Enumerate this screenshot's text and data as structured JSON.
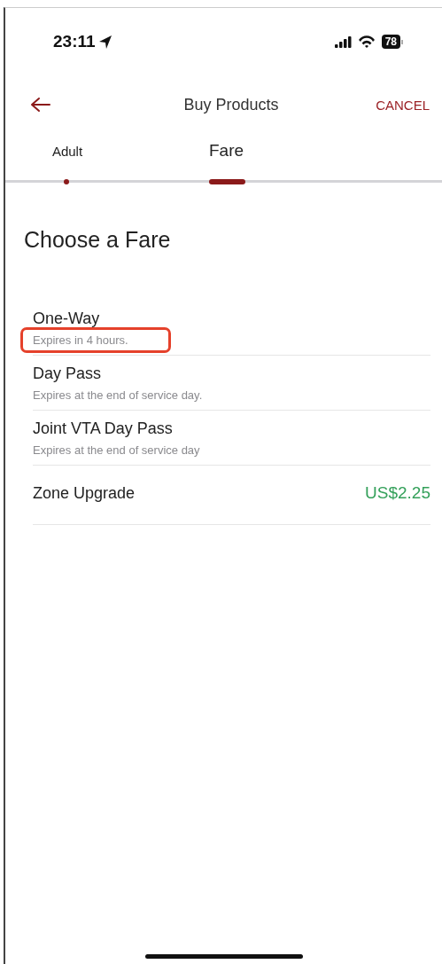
{
  "status_bar": {
    "time": "23:11",
    "battery": "78"
  },
  "nav": {
    "title": "Buy Products",
    "cancel": "CANCEL"
  },
  "tabs": [
    {
      "label": "Adult",
      "selected": false
    },
    {
      "label": "Fare",
      "selected": true
    }
  ],
  "heading": "Choose a Fare",
  "fares": [
    {
      "name": "One-Way",
      "subtitle": "Expires in 4 hours.",
      "highlighted": true
    },
    {
      "name": "Day Pass",
      "subtitle": "Expires at the end of service day.",
      "highlighted": false
    },
    {
      "name": "Joint VTA Day Pass",
      "subtitle": "Expires at the end of service day",
      "highlighted": false
    },
    {
      "name": "Zone Upgrade",
      "price": "US$2.25",
      "highlighted": false
    }
  ]
}
